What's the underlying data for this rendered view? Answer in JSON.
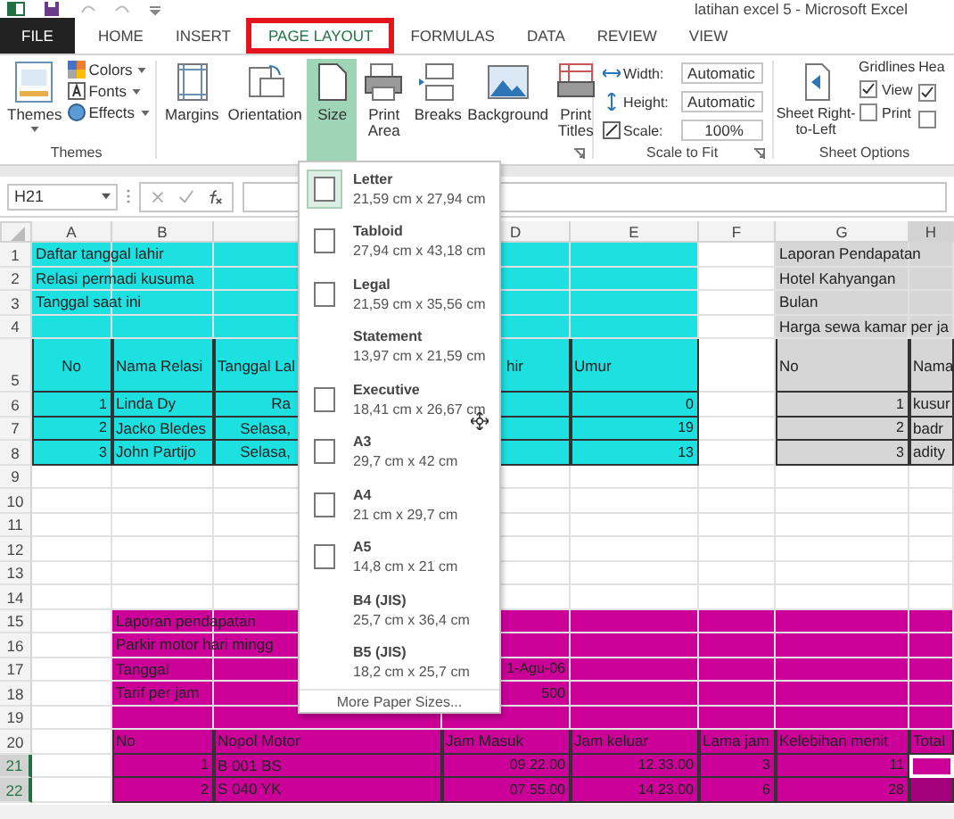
{
  "title_bar": {
    "title": "latihan excel 5 - Microsoft Excel"
  },
  "tabs": [
    {
      "label": "FILE",
      "kind": "file",
      "selected": false,
      "outlined": false
    },
    {
      "label": "HOME",
      "kind": "tab",
      "selected": false,
      "outlined": false
    },
    {
      "label": "INSERT",
      "kind": "tab",
      "selected": false,
      "outlined": false
    },
    {
      "label": "PAGE LAYOUT",
      "kind": "tab",
      "selected": true,
      "outlined": true
    },
    {
      "label": "FORMULAS",
      "kind": "tab",
      "selected": false,
      "outlined": false
    },
    {
      "label": "DATA",
      "kind": "tab",
      "selected": false,
      "outlined": false
    },
    {
      "label": "REVIEW",
      "kind": "tab",
      "selected": false,
      "outlined": false
    },
    {
      "label": "VIEW",
      "kind": "tab",
      "selected": false,
      "outlined": false
    }
  ],
  "themes_group": {
    "label": "Themes",
    "button": "Themes",
    "items": [
      {
        "label": "Colors",
        "kind": "colors"
      },
      {
        "label": "Fonts",
        "kind": "fonts"
      },
      {
        "label": "Effects",
        "kind": "effects"
      }
    ]
  },
  "page_setup_buttons": [
    {
      "label": "Margins",
      "kind": "margins",
      "selected": false
    },
    {
      "label": "Orientation",
      "kind": "orientation",
      "selected": false
    },
    {
      "label": "Size",
      "kind": "size",
      "selected": true
    },
    {
      "label": "Print Area",
      "kind": "printarea",
      "selected": false
    },
    {
      "label": "Breaks",
      "kind": "breaks",
      "selected": false
    },
    {
      "label": "Background",
      "kind": "background",
      "selected": false
    },
    {
      "label": "Print Titles",
      "kind": "titles",
      "selected": false
    }
  ],
  "scale_to_fit": {
    "label": "Scale to Fit",
    "fields": [
      {
        "label": "Width:",
        "value": "Automatic",
        "kind": "width"
      },
      {
        "label": "Height:",
        "value": "Automatic",
        "kind": "height"
      },
      {
        "label": "Scale:",
        "value": "100%",
        "kind": "scale"
      }
    ]
  },
  "sheet_options": {
    "label": "Sheet Options",
    "button": "Sheet Right-to-Left",
    "gridlines": {
      "label": "Gridlines",
      "options": [
        {
          "label": "View",
          "checked": true
        },
        {
          "label": "Print",
          "checked": false
        }
      ]
    },
    "headings": {
      "label": "Hea",
      "options": [
        {
          "checked": true
        },
        {
          "checked": false
        }
      ]
    }
  },
  "formula_bar": {
    "name_box": "H21"
  },
  "sheet": {
    "columns": [
      {
        "label": "A",
        "selected": false
      },
      {
        "label": "B",
        "selected": false
      },
      {
        "selected": false
      },
      {
        "label": "D",
        "selected": false,
        "kind": "clippedleft"
      },
      {
        "label": "E",
        "selected": false
      },
      {
        "label": "F",
        "selected": false
      },
      {
        "label": "G",
        "selected": false
      },
      {
        "label": "H",
        "selected": true
      }
    ],
    "rows": [
      {
        "label": "1",
        "selected": false,
        "cells": [
          {
            "text": "Daftar tanggal lahir",
            "color": "#1de0e0"
          },
          {
            "color": "#1de0e0"
          },
          {
            "color": "#1de0e0"
          },
          {
            "color": "#1de0e0"
          },
          {
            "color": "#1de0e0"
          },
          {},
          {
            "text": "Laporan Pendapatan",
            "color": "#d6d6d6"
          },
          {
            "color": "#d6d6d6"
          }
        ]
      },
      {
        "label": "2",
        "selected": false,
        "cells": [
          {
            "text": "Relasi permadi kusuma",
            "color": "#1de0e0"
          },
          {
            "color": "#1de0e0"
          },
          {
            "color": "#1de0e0"
          },
          {
            "color": "#1de0e0"
          },
          {
            "color": "#1de0e0"
          },
          {},
          {
            "text": "Hotel Kahyangan",
            "color": "#d6d6d6"
          },
          {
            "color": "#d6d6d6"
          }
        ]
      },
      {
        "label": "3",
        "selected": false,
        "cells": [
          {
            "text": "Tanggal saat ini",
            "color": "#1de0e0"
          },
          {
            "color": "#1de0e0"
          },
          {
            "color": "#1de0e0"
          },
          {
            "color": "#1de0e0"
          },
          {
            "color": "#1de0e0"
          },
          {},
          {
            "text": "Bulan",
            "color": "#d6d6d6"
          },
          {
            "color": "#d6d6d6"
          }
        ]
      },
      {
        "label": "4",
        "selected": false,
        "cells": [
          {
            "color": "#1de0e0"
          },
          {
            "color": "#1de0e0"
          },
          {
            "color": "#1de0e0"
          },
          {
            "color": "#1de0e0"
          },
          {
            "color": "#1de0e0"
          },
          {},
          {
            "text": "Harga sewa kamar per ja",
            "color": "#d6d6d6"
          },
          {
            "color": "#d6d6d6"
          }
        ]
      },
      {
        "label": "5",
        "selected": false,
        "cells": [
          {
            "text": "No",
            "color": "#1de0e0",
            "kind": "center",
            "bordered": true
          },
          {
            "text": "Nama Relasi",
            "color": "#1de0e0",
            "bordered": true
          },
          {
            "text": "Tanggal Lal",
            "color": "#1de0e0",
            "bordered": true
          },
          {
            "text": "hir",
            "color": "#1de0e0",
            "kind": "clippedleft",
            "bordered": true
          },
          {
            "text": "Umur",
            "color": "#1de0e0",
            "bordered": true
          },
          {},
          {
            "text": "No",
            "color": "#d6d6d6",
            "bordered": true
          },
          {
            "text": "Nama",
            "color": "#d6d6d6",
            "bordered": true
          }
        ]
      },
      {
        "label": "6",
        "selected": false,
        "cells": [
          {
            "text": "1",
            "color": "#1de0e0",
            "kind": "number",
            "bordered": true
          },
          {
            "text": "Linda Dy",
            "color": "#1de0e0",
            "bordered": true
          },
          {
            "text": "Ra",
            "color": "#1de0e0",
            "kind": "clipped",
            "bordered": true
          },
          {
            "color": "#1de0e0",
            "bordered": true
          },
          {
            "text": "0",
            "color": "#1de0e0",
            "kind": "number",
            "bordered": true
          },
          {},
          {
            "text": "1",
            "color": "#d6d6d6",
            "kind": "number",
            "bordered": true
          },
          {
            "text": "kusur",
            "color": "#d6d6d6",
            "bordered": true
          }
        ]
      },
      {
        "label": "7",
        "selected": false,
        "cells": [
          {
            "text": "2",
            "color": "#1de0e0",
            "kind": "number",
            "bordered": true
          },
          {
            "text": "Jacko Bledes",
            "color": "#1de0e0",
            "bordered": true
          },
          {
            "text": "Selasa,",
            "color": "#1de0e0",
            "kind": "clipped",
            "bordered": true
          },
          {
            "color": "#1de0e0",
            "bordered": true
          },
          {
            "text": "19",
            "color": "#1de0e0",
            "kind": "number",
            "bordered": true
          },
          {},
          {
            "text": "2",
            "color": "#d6d6d6",
            "kind": "number",
            "bordered": true
          },
          {
            "text": "badr",
            "color": "#d6d6d6",
            "bordered": true
          }
        ]
      },
      {
        "label": "8",
        "selected": false,
        "cells": [
          {
            "text": "3",
            "color": "#1de0e0",
            "kind": "number",
            "bordered": true
          },
          {
            "text": "John Partijo",
            "color": "#1de0e0",
            "bordered": true
          },
          {
            "text": "Selasa,",
            "color": "#1de0e0",
            "kind": "clipped",
            "bordered": true
          },
          {
            "color": "#1de0e0",
            "bordered": true
          },
          {
            "text": "13",
            "color": "#1de0e0",
            "kind": "number",
            "bordered": true
          },
          {},
          {
            "text": "3",
            "color": "#d6d6d6",
            "kind": "number",
            "bordered": true
          },
          {
            "text": "adity",
            "color": "#d6d6d6",
            "bordered": true
          }
        ]
      },
      {
        "label": "9",
        "selected": false,
        "cells": [
          {},
          {},
          {},
          {},
          {},
          {},
          {},
          {}
        ]
      },
      {
        "label": "10",
        "selected": false,
        "cells": [
          {},
          {},
          {},
          {},
          {},
          {},
          {},
          {}
        ]
      },
      {
        "label": "11",
        "selected": false,
        "cells": [
          {},
          {},
          {},
          {},
          {},
          {},
          {},
          {}
        ]
      },
      {
        "label": "12",
        "selected": false,
        "cells": [
          {},
          {},
          {},
          {},
          {},
          {},
          {},
          {}
        ]
      },
      {
        "label": "13",
        "selected": false,
        "cells": [
          {},
          {},
          {},
          {},
          {},
          {},
          {},
          {}
        ]
      },
      {
        "label": "14",
        "selected": false,
        "cells": [
          {},
          {},
          {},
          {},
          {},
          {},
          {},
          {}
        ]
      },
      {
        "label": "15",
        "selected": false,
        "cells": [
          {},
          {
            "text": "Laporan pendapatan",
            "color": "#cc0099"
          },
          {
            "color": "#cc0099"
          },
          {
            "color": "#cc0099"
          },
          {
            "color": "#cc0099"
          },
          {
            "color": "#cc0099"
          },
          {
            "color": "#cc0099"
          },
          {
            "color": "#cc0099"
          }
        ]
      },
      {
        "label": "16",
        "selected": false,
        "cells": [
          {},
          {
            "text": "Parkir motor hari mingg",
            "color": "#cc0099"
          },
          {
            "color": "#cc0099"
          },
          {
            "color": "#cc0099"
          },
          {
            "color": "#cc0099"
          },
          {
            "color": "#cc0099"
          },
          {
            "color": "#cc0099"
          },
          {
            "color": "#cc0099"
          }
        ]
      },
      {
        "label": "17",
        "selected": false,
        "cells": [
          {},
          {
            "text": "Tanggal",
            "color": "#cc0099"
          },
          {
            "color": "#cc0099"
          },
          {
            "text": "1-Agu-06",
            "color": "#cc0099",
            "kind": "number"
          },
          {
            "color": "#cc0099"
          },
          {
            "color": "#cc0099"
          },
          {
            "color": "#cc0099"
          },
          {
            "color": "#cc0099"
          }
        ]
      },
      {
        "label": "18",
        "selected": false,
        "cells": [
          {},
          {
            "text": "Tarif per jam",
            "color": "#cc0099"
          },
          {
            "color": "#cc0099"
          },
          {
            "text": "500",
            "color": "#cc0099",
            "kind": "number"
          },
          {
            "color": "#cc0099"
          },
          {
            "color": "#cc0099"
          },
          {
            "color": "#cc0099"
          },
          {
            "color": "#cc0099"
          }
        ]
      },
      {
        "label": "19",
        "selected": false,
        "cells": [
          {},
          {
            "color": "#cc0099"
          },
          {
            "color": "#cc0099"
          },
          {
            "color": "#cc0099"
          },
          {
            "color": "#cc0099"
          },
          {
            "color": "#cc0099"
          },
          {
            "color": "#cc0099"
          },
          {
            "color": "#cc0099"
          }
        ]
      },
      {
        "label": "20",
        "selected": false,
        "cells": [
          {},
          {
            "text": "No",
            "color": "#cc0099",
            "bordered": true
          },
          {
            "text": "Nopol Motor",
            "color": "#cc0099",
            "bordered": true
          },
          {
            "text": "Jam Masuk",
            "color": "#cc0099",
            "bordered": true
          },
          {
            "text": "Jam keluar",
            "color": "#cc0099",
            "bordered": true
          },
          {
            "text": "Lama jam",
            "color": "#cc0099",
            "bordered": true
          },
          {
            "text": "Kelebihan menit",
            "color": "#cc0099",
            "bordered": true
          },
          {
            "text": "Total",
            "color": "#cc0099",
            "bordered": true
          }
        ]
      },
      {
        "label": "21",
        "selected": true,
        "cells": [
          {},
          {
            "text": "1",
            "color": "#cc0099",
            "kind": "number",
            "bordered": true
          },
          {
            "text": "B 001 BS",
            "color": "#cc0099",
            "bordered": true
          },
          {
            "text": "09.22.00",
            "color": "#cc0099",
            "kind": "number",
            "bordered": true
          },
          {
            "text": "12.33.00",
            "color": "#cc0099",
            "kind": "number",
            "bordered": true
          },
          {
            "text": "3",
            "color": "#cc0099",
            "kind": "number",
            "bordered": true
          },
          {
            "text": "11",
            "color": "#cc0099",
            "kind": "number",
            "bordered": true
          },
          {
            "color": "#cc0099",
            "bordered": true,
            "selected": true
          }
        ]
      },
      {
        "label": "22",
        "selected": true,
        "cells": [
          {},
          {
            "text": "2",
            "color": "#cc0099",
            "kind": "number",
            "bordered": true
          },
          {
            "text": "S 040 YK",
            "color": "#cc0099",
            "bordered": true
          },
          {
            "text": "07.55.00",
            "color": "#cc0099",
            "kind": "number",
            "bordered": true
          },
          {
            "text": "14.23.00",
            "color": "#cc0099",
            "kind": "number",
            "bordered": true
          },
          {
            "text": "6",
            "color": "#cc0099",
            "kind": "number",
            "bordered": true
          },
          {
            "text": "28",
            "color": "#cc0099",
            "kind": "number",
            "bordered": true
          },
          {
            "color": "#a3007c",
            "bordered": true
          }
        ]
      }
    ]
  },
  "size_menu": {
    "items": [
      {
        "name": "Letter",
        "dims": "21,59 cm x 27,94 cm",
        "selected": true,
        "kind": "page"
      },
      {
        "name": "Tabloid",
        "dims": "27,94 cm x 43,18 cm",
        "selected": false,
        "kind": "page"
      },
      {
        "name": "Legal",
        "dims": "21,59 cm x 35,56 cm",
        "selected": false,
        "kind": "page"
      },
      {
        "name": "Statement",
        "dims": "13,97 cm x 21,59 cm",
        "selected": false,
        "kind": "blank"
      },
      {
        "name": "Executive",
        "dims": "18,41 cm x 26,67 cm",
        "selected": false,
        "kind": "page"
      },
      {
        "name": "A3",
        "dims": "29,7 cm x 42 cm",
        "selected": false,
        "kind": "page"
      },
      {
        "name": "A4",
        "dims": "21 cm x 29,7 cm",
        "selected": false,
        "kind": "page"
      },
      {
        "name": "A5",
        "dims": "14,8 cm x 21 cm",
        "selected": false,
        "kind": "page"
      },
      {
        "name": "B4 (JIS)",
        "dims": "25,7 cm x 36,4 cm",
        "selected": false,
        "kind": "blank"
      },
      {
        "name": "B5 (JIS)",
        "dims": "18,2 cm x 25,7 cm",
        "selected": false,
        "kind": "blank"
      }
    ],
    "more": "More Paper Sizes..."
  }
}
